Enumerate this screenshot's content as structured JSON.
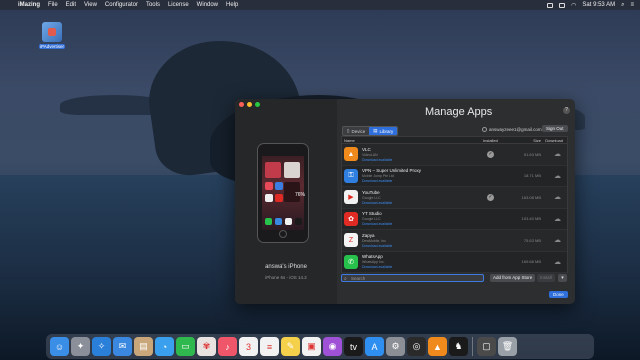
{
  "menubar": {
    "items": [
      "iMazing",
      "File",
      "Edit",
      "View",
      "Configurator",
      "Tools",
      "License",
      "Window",
      "Help"
    ],
    "clock": "Sat 9:53 AM"
  },
  "desktop": {
    "icon_label": "iPAdvertiser"
  },
  "window": {
    "title": "Manage Apps",
    "help": "?",
    "device": {
      "name": "answa's iPhone",
      "sub": "iPhone 6s - iOS 14.2",
      "battery_widget": "76%"
    },
    "segments": [
      {
        "label": "Device",
        "icon": "phone-icon",
        "active": false
      },
      {
        "label": "Library",
        "icon": "library-icon",
        "active": true
      }
    ],
    "account": "answayzeee1@gmail.com",
    "sign_out": "Sign Out",
    "table": {
      "headers": {
        "name": "Name",
        "installed": "Installed",
        "size": "Size",
        "download": "Download"
      },
      "rows": [
        {
          "name": "VLC",
          "dev": "VideoLAN",
          "status": "Download available",
          "installed": true,
          "size": "51.63 MB",
          "color": "#f08a1c",
          "glyph": "▲"
        },
        {
          "name": "VPN – Super Unlimited Proxy",
          "dev": "Mobile Jump Pte Ltd",
          "status": "Download available",
          "installed": false,
          "size": "18.71 MB",
          "color": "#2e7fe0",
          "glyph": "⚿"
        },
        {
          "name": "YouTube",
          "dev": "Google LLC",
          "status": "Download available",
          "installed": true,
          "size": "163.08 MB",
          "color": "#f2f2f2",
          "glyph": "▶"
        },
        {
          "name": "YT Studio",
          "dev": "Google LLC",
          "status": "Download available",
          "installed": false,
          "size": "103.40 MB",
          "color": "#e02a24",
          "glyph": "✿"
        },
        {
          "name": "Zapya",
          "dev": "DewMobile, Inc",
          "status": "Download available",
          "installed": false,
          "size": "75.63 MB",
          "color": "#f4f4f4",
          "glyph": "Z"
        },
        {
          "name": "WhatsApp",
          "dev": "WhatsApp Inc.",
          "status": "Download available",
          "installed": false,
          "size": "169.68 MB",
          "color": "#27c24c",
          "glyph": "✆"
        }
      ]
    },
    "search_placeholder": "Search",
    "add_button": "Add from App Store",
    "install_button": "Install",
    "more_button": "▾",
    "done_button": "Done"
  },
  "dock": {
    "apps": [
      {
        "name": "finder",
        "color": "#3a8ee6",
        "glyph": "☺"
      },
      {
        "name": "launchpad",
        "color": "#8a8f99",
        "glyph": "✦"
      },
      {
        "name": "safari",
        "color": "#2a7fd8",
        "glyph": "✧"
      },
      {
        "name": "mail",
        "color": "#3b88e0",
        "glyph": "✉"
      },
      {
        "name": "contacts",
        "color": "#c9a77a",
        "glyph": "▤"
      },
      {
        "name": "messages",
        "color": "#3aa0ee",
        "glyph": "◔"
      },
      {
        "name": "facetime",
        "color": "#2fb84d",
        "glyph": "▭"
      },
      {
        "name": "photos",
        "color": "#e8e3e0",
        "glyph": "✾"
      },
      {
        "name": "music",
        "color": "#f0566a",
        "glyph": "♪"
      },
      {
        "name": "calendar",
        "color": "#f2f2f2",
        "glyph": "3"
      },
      {
        "name": "reminders",
        "color": "#f2f2f2",
        "glyph": "≡"
      },
      {
        "name": "notes",
        "color": "#f5d04a",
        "glyph": "✎"
      },
      {
        "name": "imazing",
        "color": "#f2f2f2",
        "glyph": "▣"
      },
      {
        "name": "podcasts",
        "color": "#a052d6",
        "glyph": "◉"
      },
      {
        "name": "apple-tv",
        "color": "#1a1a1a",
        "glyph": "tv"
      },
      {
        "name": "app-store",
        "color": "#2e8ff0",
        "glyph": "A"
      },
      {
        "name": "system-preferences",
        "color": "#8c8f95",
        "glyph": "⚙"
      },
      {
        "name": "obs",
        "color": "#2a2a2a",
        "glyph": "◎"
      },
      {
        "name": "vlc",
        "color": "#f08a1c",
        "glyph": "▲"
      },
      {
        "name": "stocks",
        "color": "#1a1a1a",
        "glyph": "♞"
      },
      {
        "name": "screenshot",
        "color": "#4a4a4a",
        "glyph": "▢"
      },
      {
        "name": "trash",
        "color": "#9aa0a8",
        "glyph": "🗑"
      }
    ]
  }
}
